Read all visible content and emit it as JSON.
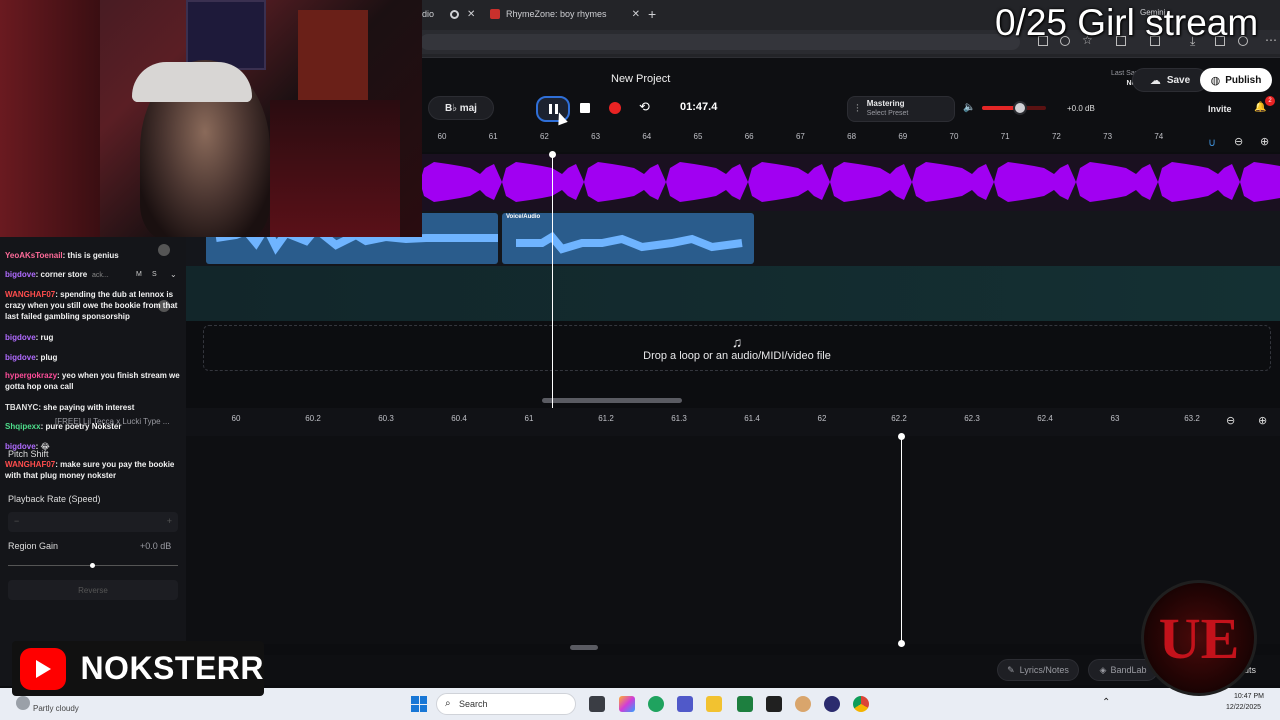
{
  "browser": {
    "tab_partial": "dio",
    "tab_active": "RhymeZone: boy rhymes",
    "new_tab": "+",
    "profile_label": "Gemini"
  },
  "overlay": {
    "stream_title": "0/25 Girl stream",
    "channel_name": "NOKSTERR",
    "badge_text": "UE"
  },
  "header": {
    "project_title": "New Project",
    "last_saved_label": "Last Saved",
    "last_saved_value": "Never",
    "save_label": "Save",
    "publish_label": "Publish"
  },
  "transport": {
    "key_label": "B♭ maj",
    "time": "01:47.4",
    "mastering_label": "Mastering",
    "mastering_preset": "Select Preset",
    "volume_db": "+0.0 dB",
    "volume_level": 0.6,
    "invite_label": "Invite",
    "notification_count": "2"
  },
  "ruler": {
    "ticks": [
      "60",
      "61",
      "62",
      "63",
      "64",
      "65",
      "66",
      "67",
      "68",
      "69",
      "70",
      "71",
      "72",
      "73",
      "74"
    ]
  },
  "tracks": {
    "clip_label": "Voice/Audio",
    "drop_text": "Drop a loop or an audio/MIDI/video file"
  },
  "detail_ruler": {
    "ticks": [
      "60",
      "60.2",
      "60.3",
      "60.4",
      "61",
      "61.2",
      "61.3",
      "61.4",
      "62",
      "62.2",
      "62.3",
      "62.4",
      "63",
      "63.2"
    ]
  },
  "left_panel": {
    "track_name_partial": "corner store",
    "track_type_partial": "ack...",
    "mute": "M",
    "solo": "S",
    "rug_partial": "rug",
    "preset_partial": "[FREE] Lil Tecca x Lucki Type ...",
    "pitch_shift": "Pitch Shift",
    "playback_rate": "Playback Rate (Speed)",
    "region_gain": "Region Gain",
    "region_gain_value": "+0.0 dB",
    "reverse": "Reverse"
  },
  "chat": [
    {
      "user": "YeoAKsToenail",
      "color": "#ff6b9a",
      "text": "this is genius"
    },
    {
      "user": "bigdove",
      "color": "#b06bff",
      "text": "corner store"
    },
    {
      "user": "WANGHAF07",
      "color": "#ff4d4d",
      "text": "spending the dub at lennox is crazy when you still owe the bookie from that last failed gambling sponsorship"
    },
    {
      "user": "bigdove",
      "color": "#b06bff",
      "text": "rug"
    },
    {
      "user": "bigdove",
      "color": "#b06bff",
      "text": "plug"
    },
    {
      "user": "hypergokrazy",
      "color": "#ff4d9a",
      "text": "yeo when you finish stream we gotta hop ona call"
    },
    {
      "user": "TBANYC",
      "color": "#e0e0e0",
      "text": "she paying with interest"
    },
    {
      "user": "Shqipexx",
      "color": "#4ddc8a",
      "text": "pure poetry Nokster"
    },
    {
      "user": "bigdove",
      "color": "#b06bff",
      "text": "😂"
    },
    {
      "user": "WANGHAF07",
      "color": "#ff4d4d",
      "text": "make sure you pay the bookie with that plug money nokster"
    }
  ],
  "bottom_bar": {
    "lyrics_label": "Lyrics/Notes",
    "bandlab_label": "BandLab",
    "shortcuts_partial": "rtcuts"
  },
  "taskbar": {
    "weather": "Partly cloudy",
    "search_placeholder": "Search",
    "time": "10:47 PM",
    "date": "12/22/2025"
  },
  "colors": {
    "purple_wave": "#a100f2",
    "blue_wave": "#3f8fd6",
    "record_red": "#e82323",
    "accent_blue": "#2f6fd8"
  }
}
